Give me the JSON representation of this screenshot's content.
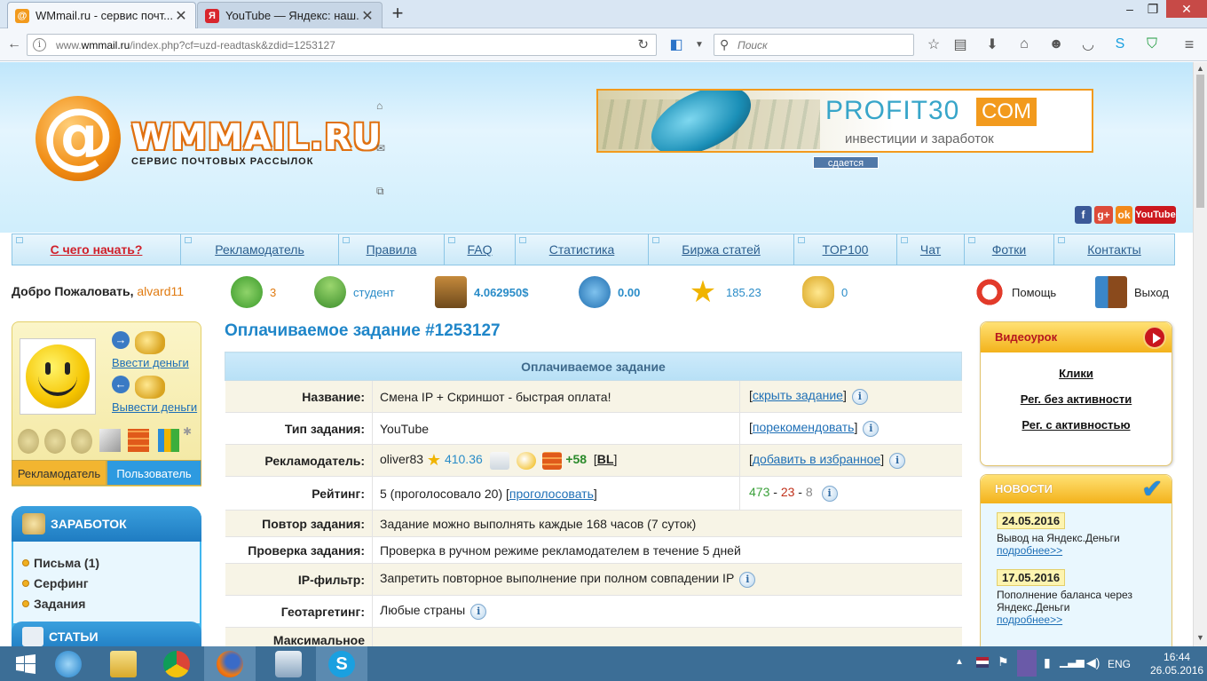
{
  "browser": {
    "tabs": [
      {
        "title": "WMmail.ru - сервис почт...",
        "favicon": "wmmail-favicon-icon",
        "active": true
      },
      {
        "title": "YouTube — Яндекс: наш...",
        "favicon": "yandex-favicon-icon",
        "active": false
      }
    ],
    "url_prefix": "www.",
    "url_domain": "wmmail.ru",
    "url_path": "/index.php?cf=uzd-readtask&zdid=1253127",
    "search_placeholder": "Поиск"
  },
  "header": {
    "logo_name": "WMMAIL.RU",
    "logo_tagline": "СЕРВИС ПОЧТОВЫХ РАССЫЛОК",
    "banner_title": "PROFIT30",
    "banner_tld": "COM",
    "banner_subtitle": "инвестиции и заработок",
    "banner_rent": "сдается",
    "social": [
      "f",
      "g+",
      "ok",
      "YouTube"
    ]
  },
  "menu": [
    {
      "label": "С чего начать?",
      "highlight": true
    },
    {
      "label": "Рекламодатель"
    },
    {
      "label": "Правила"
    },
    {
      "label": "FAQ"
    },
    {
      "label": "Статистика"
    },
    {
      "label": "Биржа статей"
    },
    {
      "label": "TOP100"
    },
    {
      "label": "Чат"
    },
    {
      "label": "Фотки"
    },
    {
      "label": "Контакты"
    }
  ],
  "status": {
    "welcome": "Добро Пожаловать,",
    "username": "alvard11",
    "referrals": "3",
    "status_label": "студент",
    "balance": "4.062950$",
    "credits": "0.00",
    "rating": "185.23",
    "coins": "0",
    "help": "Помощь",
    "logout": "Выход"
  },
  "sidebar": {
    "deposit": "Ввести деньги",
    "withdraw": "Вывести деньги",
    "tab_advertiser": "Рекламодатель",
    "tab_user": "Пользователь",
    "earn_title": "ЗАРАБОТОК",
    "earn_items": [
      "Письма (1)",
      "Серфинг",
      "Задания"
    ],
    "articles_title": "СТАТЬИ"
  },
  "task": {
    "title": "Оплачиваемое задание #1253127",
    "table_header": "Оплачиваемое задание",
    "name_label": "Название:",
    "name_value": "Смена IP + Скриншот - быстрая оплата!",
    "hide_link": "скрыть задание",
    "type_label": "Тип задания:",
    "type_value": "YouTube",
    "recommend_link": "порекомендовать",
    "advertiser_label": "Рекламодатель:",
    "advertiser_name": "oliver83",
    "advertiser_rating": "410.36",
    "advertiser_score": "+58",
    "advertiser_bl": "BL",
    "favorite_link": "добавить в избранное",
    "rating_label": "Рейтинг:",
    "rating_value": "5 (проголосовало 20)",
    "vote_link": "проголосовать",
    "stat_good": "473",
    "stat_bad": "23",
    "stat_neutral": "8",
    "repeat_label": "Повтор задания:",
    "repeat_value": "Задание можно выполнять каждые 168 часов (7 суток)",
    "check_label": "Проверка задания:",
    "check_value": "Проверка в ручном режиме рекламодателем в течение 5 дней",
    "ip_label": "IP-фильтр:",
    "ip_value": "Запретить повторное выполнение при полном совпадении IP",
    "geo_label": "Геотаргетинг:",
    "geo_value": "Любые страны",
    "max_label": "Максимальное"
  },
  "right": {
    "video_title": "Видеоурок",
    "video_links": [
      "Клики",
      "Рег. без активности",
      "Рег. с активностью"
    ],
    "news_title": "НОВОСТИ",
    "news": [
      {
        "date": "24.05.2016",
        "text": "Вывод на Яндекс.Деньги",
        "more": "подробнее>>"
      },
      {
        "date": "17.05.2016",
        "text": "Пополнение баланса через Яндекс.Деньги",
        "more": "подробнее>>"
      }
    ]
  },
  "taskbar": {
    "lang": "ENG",
    "time": "16:44",
    "date": "26.05.2016"
  },
  "colors": {
    "accent": "#1f86c9",
    "orange": "#f29a1d",
    "taskbar": "#3c6e96"
  }
}
